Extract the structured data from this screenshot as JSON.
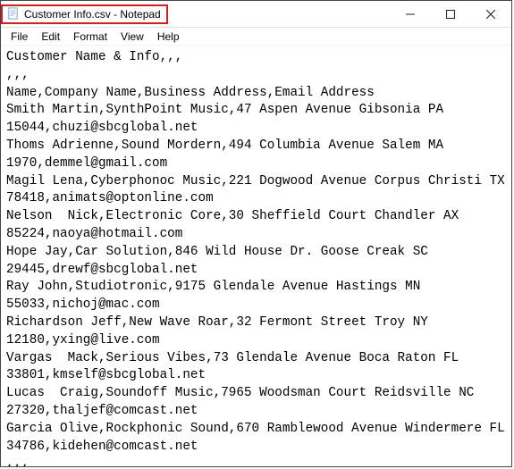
{
  "window": {
    "title": "Customer Info.csv - Notepad",
    "controls": {
      "minimize": "—",
      "maximize": "☐",
      "close": "✕"
    }
  },
  "menubar": {
    "file": "File",
    "edit": "Edit",
    "format": "Format",
    "view": "View",
    "help": "Help"
  },
  "lines": {
    "l0": "Customer Name & Info,,,",
    "l1": ",,,",
    "l2": "Name,Company Name,Business Address,Email Address",
    "l3": "Smith Martin,SynthPoint Music,47 Aspen Avenue Gibsonia PA",
    "l4": "15044,chuzi@sbcglobal.net",
    "l5": "Thoms Adrienne,Sound Mordern,494 Columbia Avenue Salem MA",
    "l6": "1970,demmel@gmail.com",
    "l7": "Magil Lena,Cyberphonoc Music,221 Dogwood Avenue Corpus Christi TX",
    "l8": "78418,animats@optonline.com",
    "l9": "Nelson  Nick,Electronic Core,30 Sheffield Court Chandler AX",
    "l10": "85224,naoya@hotmail.com",
    "l11": "Hope Jay,Car Solution,846 Wild House Dr. Goose Creak SC",
    "l12": "29445,drewf@sbcglobal.net",
    "l13": "Ray John,Studiotronic,9175 Glendale Avenue Hastings MN",
    "l14": "55033,nichoj@mac.com",
    "l15": "Richardson Jeff,New Wave Roar,32 Fermont Street Troy NY",
    "l16": "12180,yxing@live.com",
    "l17": "Vargas  Mack,Serious Vibes,73 Glendale Avenue Boca Raton FL",
    "l18": "33801,kmself@sbcglobal.net",
    "l19": "Lucas  Craig,Soundoff Music,7965 Woodsman Court Reidsville NC",
    "l20": "27320,thaljef@comcast.net",
    "l21": "Garcia Olive,Rockphonic Sound,670 Ramblewood Avenue Windermere FL",
    "l22": "34786,kidehen@comcast.net",
    "l23": ",,,"
  }
}
